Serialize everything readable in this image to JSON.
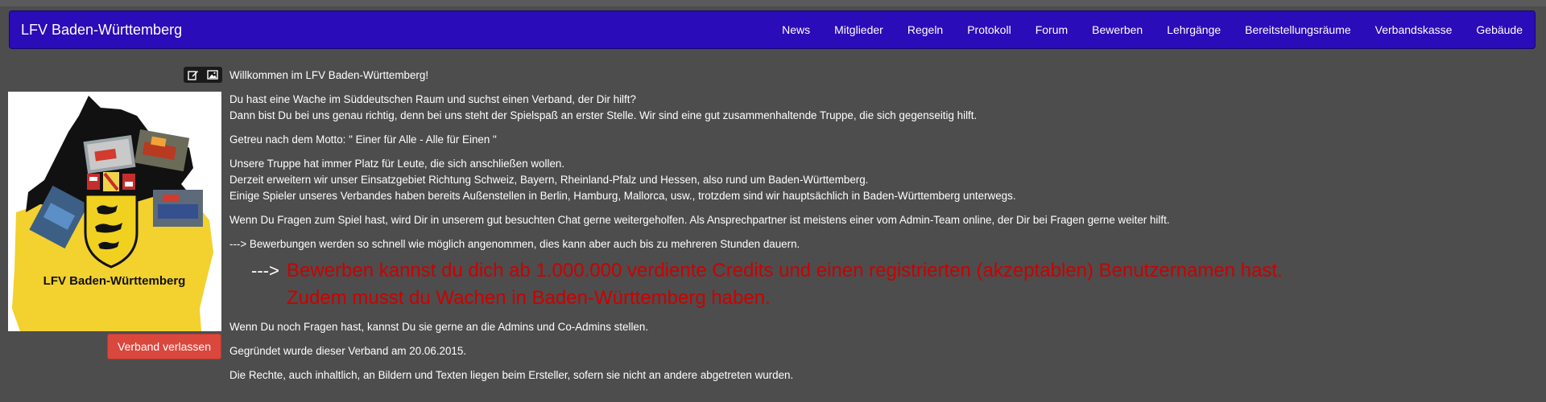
{
  "navbar": {
    "brand": "LFV Baden-Württemberg",
    "items": [
      "News",
      "Mitglieder",
      "Regeln",
      "Protokoll",
      "Forum",
      "Bewerben",
      "Lehrgänge",
      "Bereitstellungsräume",
      "Verbandskasse",
      "Gebäude"
    ]
  },
  "sidebar": {
    "logo_caption": "LFV Baden-Württemberg",
    "leave_button": "Verband verlassen",
    "edit_icon": "edit-icon",
    "image_icon": "image-icon"
  },
  "content": {
    "welcome": "Willkommen im LFV Baden-Württemberg!",
    "intro_1": "Du hast eine Wache im Süddeutschen Raum und suchst einen Verband, der Dir hilft?",
    "intro_2": "Dann bist Du bei uns genau richtig, denn bei uns steht der Spielspaß an erster Stelle. Wir sind eine gut zusammenhaltende Truppe, die sich gegenseitig hilft.",
    "motto": "Getreu nach dem Motto: \" Einer für Alle - Alle für Einen \"",
    "troop_1": "Unsere Truppe hat immer Platz für Leute, die sich anschließen wollen.",
    "troop_2": "Derzeit erweitern wir unser Einsatzgebiet Richtung Schweiz, Bayern, Rheinland-Pfalz und Hessen, also rund um Baden-Württemberg.",
    "troop_3": "Einige Spieler unseres Verbandes haben bereits Außenstellen in Berlin, Hamburg, Mallorca, usw., trotzdem sind wir hauptsächlich in Baden-Württemberg unterwegs.",
    "chat": "Wenn Du Fragen zum Spiel hast, wird Dir in unserem gut besuchten Chat gerne weitergeholfen. Als Ansprechpartner ist meistens einer vom Admin-Team online, der Dir bei Fragen gerne weiter hilft.",
    "applications": "---> Bewerbungen werden so schnell wie möglich angenommen, dies kann aber auch bis zu mehreren Stunden dauern.",
    "big_arrow": "--->",
    "big_1": "Bewerben kannst du dich ab 1.000.000 verdiente Credits und einen registrierten (akzeptablen) Benutzernamen hast.",
    "big_2": "Zudem musst du Wachen in Baden-Württemberg haben.",
    "questions": "Wenn Du noch Fragen hast, kannst Du sie gerne an die Admins und Co-Admins stellen.",
    "founded": "Gegründet wurde dieser Verband am 20.06.2015.",
    "rights": "Die Rechte, auch inhaltlich, an Bildern und Texten liegen beim Ersteller, sofern sie nicht an andere abgetreten wurden."
  },
  "colors": {
    "navbar": "#2a0cb8",
    "background": "#4d4d4d",
    "danger": "#d9473d",
    "highlight_text": "#cc0000"
  }
}
